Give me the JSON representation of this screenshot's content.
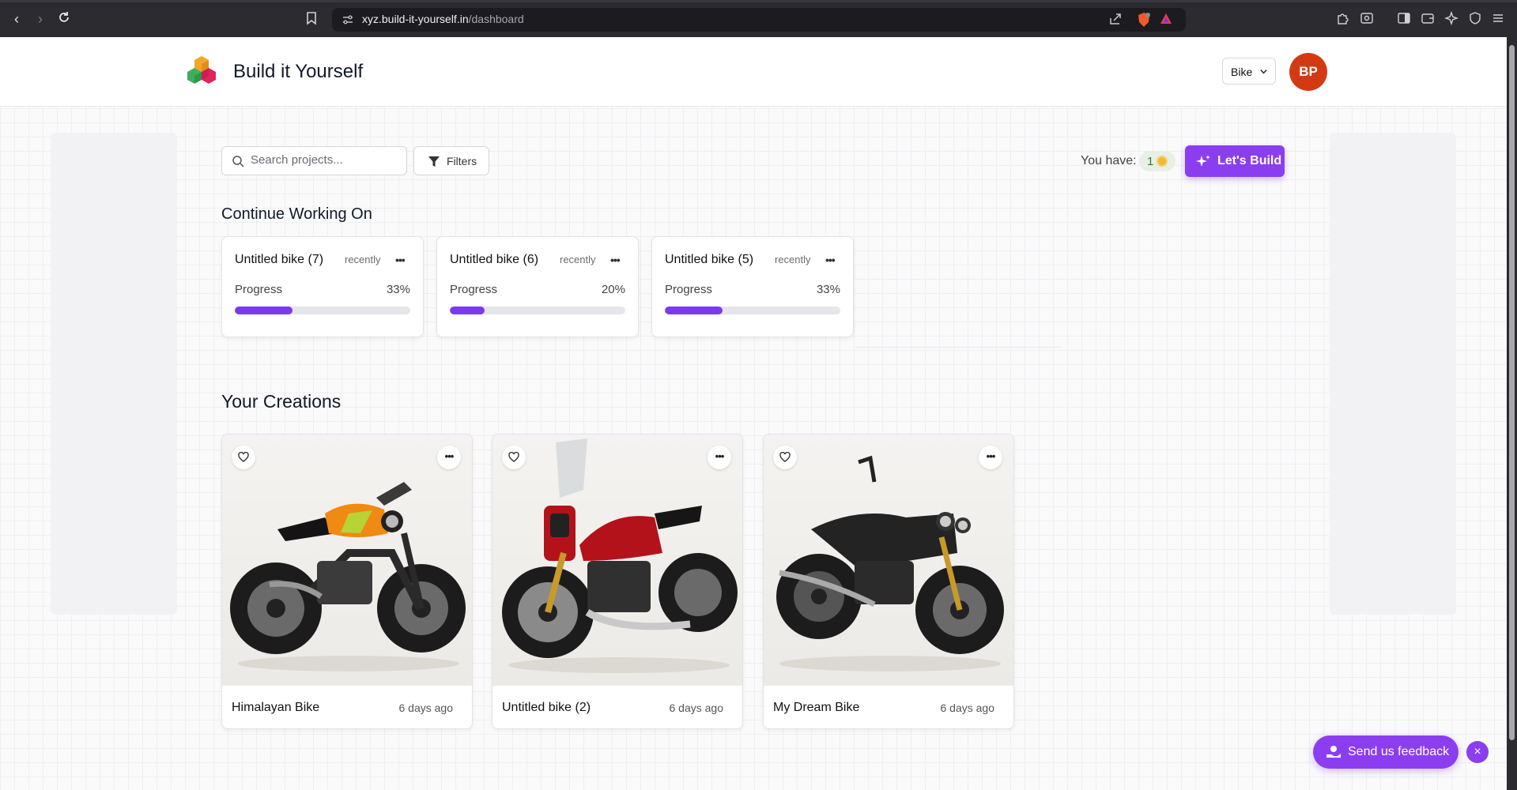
{
  "browser": {
    "url_host": "xyz.build-it-yourself.in",
    "url_path": "/dashboard"
  },
  "header": {
    "brand": "Build it Yourself",
    "category_select": "Bike",
    "avatar_initials": "BP"
  },
  "toolbar": {
    "search_placeholder": "Search projects...",
    "filters_label": "Filters",
    "you_have_label": "You have:",
    "credits": "1",
    "build_label": "Let's Build"
  },
  "continue_section": {
    "title": "Continue Working On",
    "progress_label": "Progress",
    "cards": [
      {
        "name": "Untitled bike (7)",
        "time": "recently",
        "progress_text": "33%",
        "progress": 0.33
      },
      {
        "name": "Untitled bike (6)",
        "time": "recently",
        "progress_text": "20%",
        "progress": 0.2
      },
      {
        "name": "Untitled bike (5)",
        "time": "recently",
        "progress_text": "33%",
        "progress": 0.33
      }
    ]
  },
  "creations_section": {
    "title": "Your Creations",
    "cards": [
      {
        "title": "Himalayan Bike",
        "ago": "6 days ago",
        "image": "orange-scrambler-motorcycle"
      },
      {
        "title": "Untitled bike (2)",
        "ago": "6 days ago",
        "image": "red-touring-motorcycle"
      },
      {
        "title": "My Dream Bike",
        "ago": "6 days ago",
        "image": "black-cafe-racer-motorcycle"
      }
    ]
  },
  "feedback": {
    "label": "Send us feedback",
    "close": "×"
  },
  "colors": {
    "accent": "#8b3ef0",
    "progress": "#7c3aed",
    "avatar": "#d33a14"
  }
}
